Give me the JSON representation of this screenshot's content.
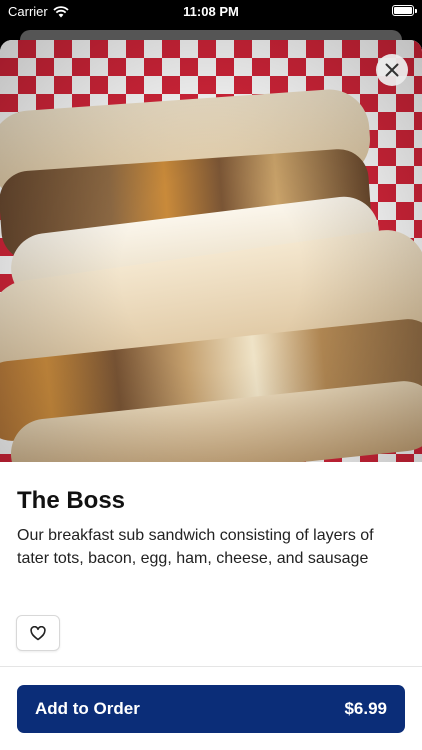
{
  "status_bar": {
    "carrier": "Carrier",
    "time": "11:08 PM",
    "icons": [
      "wifi-icon",
      "battery-icon"
    ]
  },
  "item": {
    "image": "sandwich-photo",
    "title": "The Boss",
    "description": "Our breakfast sub sandwich consisting of layers of tater tots, bacon, egg, ham, cheese, and sausage"
  },
  "actions": {
    "close_icon": "close-icon",
    "favorite_icon": "heart-icon",
    "add_label": "Add to Order",
    "price": "$6.99"
  },
  "colors": {
    "accent": "#0b2d78",
    "checker_red": "#d6253a"
  }
}
